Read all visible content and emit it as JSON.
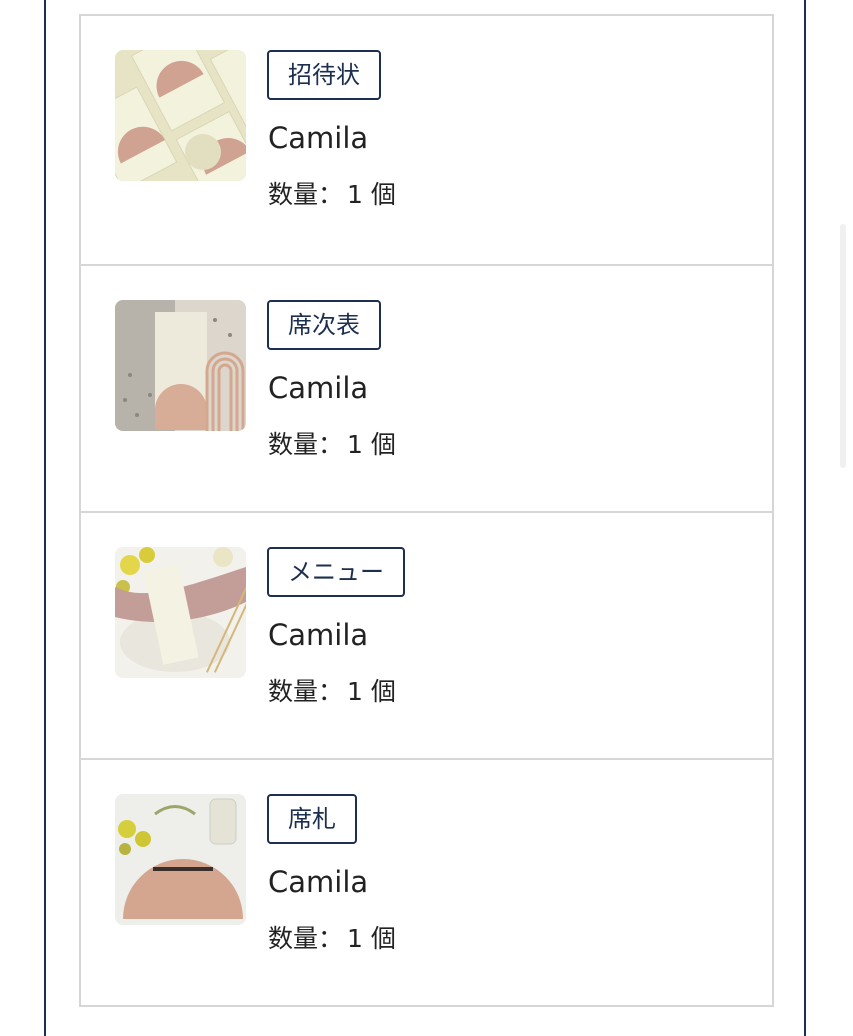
{
  "items": [
    {
      "category": "招待状",
      "name": "Camila",
      "quantity_label": "数量：",
      "quantity": "1",
      "unit": "個",
      "thumbnail_icon": "invitation-card-image"
    },
    {
      "category": "席次表",
      "name": "Camila",
      "quantity_label": "数量：",
      "quantity": "1",
      "unit": "個",
      "thumbnail_icon": "seating-chart-image"
    },
    {
      "category": "メニュー",
      "name": "Camila",
      "quantity_label": "数量：",
      "quantity": "1",
      "unit": "個",
      "thumbnail_icon": "menu-card-image"
    },
    {
      "category": "席札",
      "name": "Camila",
      "quantity_label": "数量：",
      "quantity": "1",
      "unit": "個",
      "thumbnail_icon": "place-card-image"
    }
  ],
  "colors": {
    "accent": "#1c2f4f",
    "divider": "#d6d6d6",
    "text": "#222222"
  }
}
